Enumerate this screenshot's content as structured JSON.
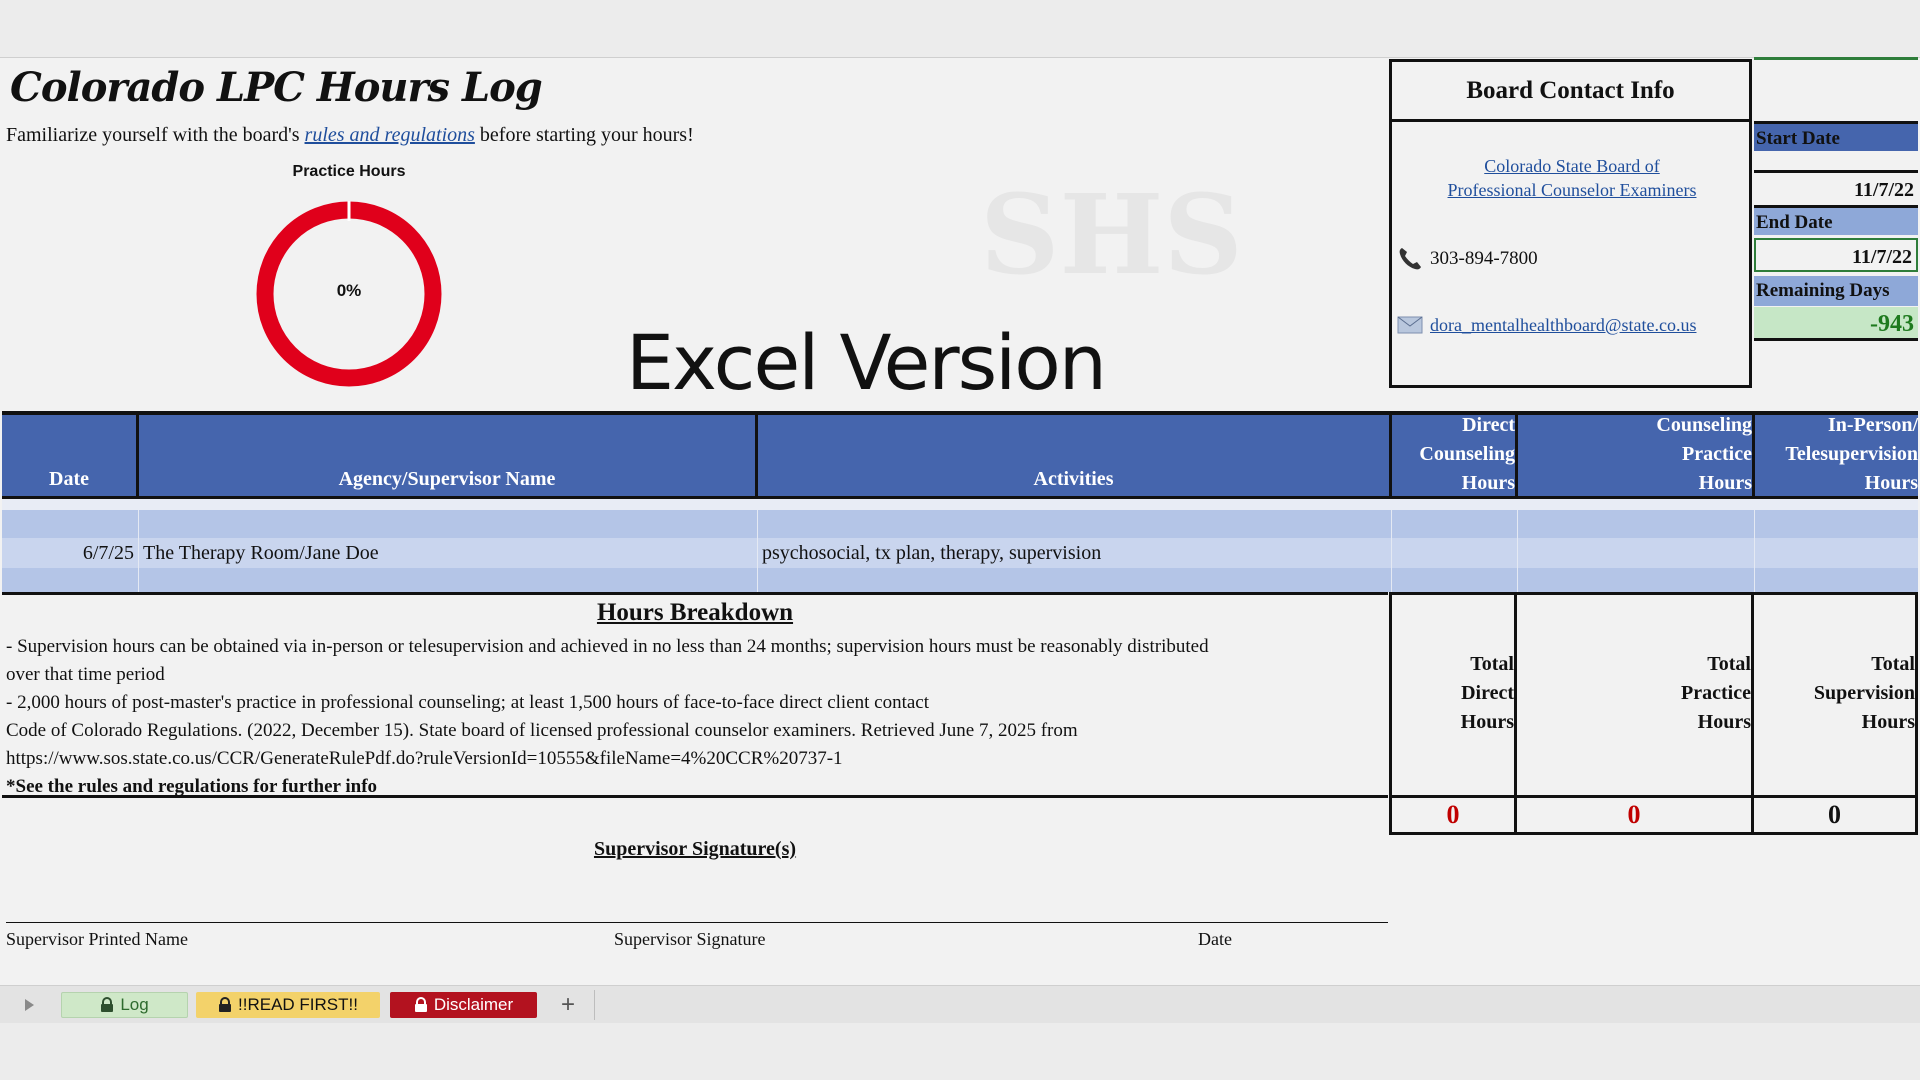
{
  "title": "Colorado LPC Hours Log",
  "intro": {
    "before": "Familiarize yourself with the board's ",
    "link": "rules and regulations",
    "after": " before starting your hours!"
  },
  "donut": {
    "title": "Practice Hours",
    "percent_label": "0%",
    "percent": 0,
    "color": "#e0001b"
  },
  "banner": "Excel Version",
  "board": {
    "header": "Board Contact Info",
    "link_line1": "Colorado State Board of",
    "link_line2": "Professional Counselor Examiners",
    "phone": "303-894-7800",
    "email": "dora_mentalhealthboard@state.co.us"
  },
  "dates": {
    "start_label": "Start Date",
    "start_value": "11/7/22",
    "end_label": "End Date",
    "end_value": "11/7/22",
    "remaining_label": "Remaining Days",
    "remaining_value": "-943"
  },
  "table": {
    "headers": {
      "date": "Date",
      "agency": "Agency/Supervisor Name",
      "activities": "Activities",
      "direct_1": "Direct",
      "direct_2": "Counseling",
      "direct_3": "Hours",
      "practice_1": "Counseling",
      "practice_2": "Practice",
      "practice_3": "Hours",
      "super_1": "In-Person/",
      "super_2": "Telesupervision",
      "super_3": "Hours"
    },
    "row": {
      "date": "6/7/25",
      "agency": "The Therapy Room/Jane Doe",
      "activities": "psychosocial, tx plan, therapy, supervision"
    }
  },
  "breakdown": {
    "title": "Hours Breakdown",
    "line1": "- Supervision hours can be obtained via in-person or telesupervision and achieved in no less than 24 months; supervision hours must be reasonably distributed",
    "line2": "over that time period",
    "line3": "- 2,000 hours of post-master's practice in professional counseling; at least 1,500 hours of face-to-face direct client contact",
    "line4": "Code of Colorado Regulations. (2022, December 15). State board of licensed professional counselor examiners. Retrieved June 7, 2025 from",
    "line5": "https://www.sos.state.co.us/CCR/GenerateRulePdf.do?ruleVersionId=10555&fileName=4%20CCR%20737-1",
    "line6": "*See the rules and regulations for further info"
  },
  "totals": {
    "direct_1": "Total",
    "direct_2": "Direct",
    "direct_3": "Hours",
    "direct_value": "0",
    "practice_1": "Total",
    "practice_2": "Practice",
    "practice_3": "Hours",
    "practice_value": "0",
    "super_1": "Total",
    "super_2": "Supervision",
    "super_3": "Hours",
    "super_value": "0"
  },
  "signature": {
    "title": "Supervisor Signature(s)",
    "printed_name": "Supervisor Printed Name",
    "signature": "Supervisor Signature",
    "date": "Date"
  },
  "tabs": {
    "log": "Log",
    "read_first": "!!READ FIRST!!",
    "disclaimer": "Disclaimer",
    "add": "+"
  },
  "colors": {
    "header_blue": "#4565ad",
    "row_light": "#b4c5e7",
    "row_mid": "#c9d5ee",
    "red_total": "#c00000",
    "remaining_green_bg": "#c6e7c6",
    "remaining_green_text": "#1e7a1e",
    "tab_log": "#cfe8c8",
    "tab_read": "#f3d26a",
    "tab_disclaimer": "#b3121f"
  }
}
